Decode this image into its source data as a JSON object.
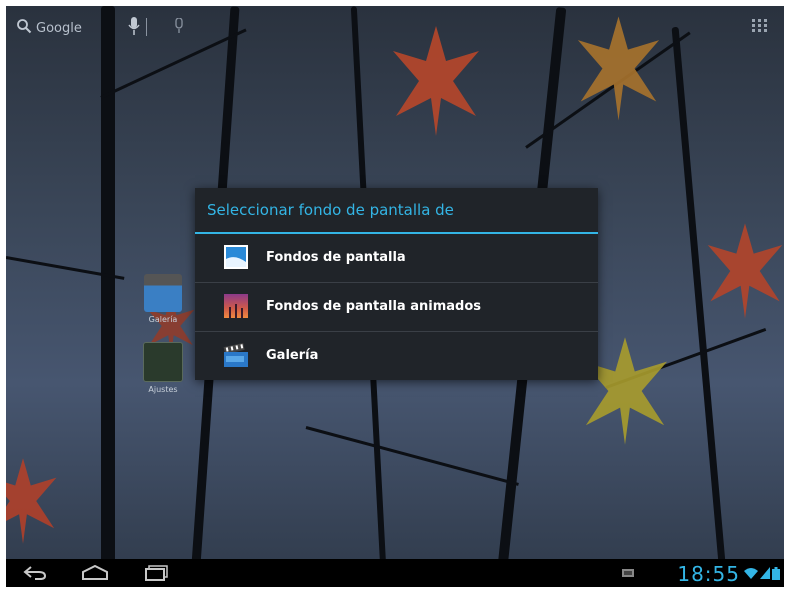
{
  "topbar": {
    "search_label": "Google"
  },
  "desktop": {
    "icons": [
      {
        "label": "Galería"
      },
      {
        "label": "Ajustes"
      }
    ]
  },
  "dialog": {
    "title": "Seleccionar fondo de pantalla de",
    "options": [
      {
        "label": "Fondos de pantalla",
        "icon": "wallpaper-icon"
      },
      {
        "label": "Fondos de pantalla animados",
        "icon": "live-wallpaper-icon"
      },
      {
        "label": "Galería",
        "icon": "gallery-icon"
      }
    ]
  },
  "statusbar": {
    "time": "18:55"
  },
  "colors": {
    "accent": "#33b5e5",
    "dialog_bg": "#202429"
  }
}
